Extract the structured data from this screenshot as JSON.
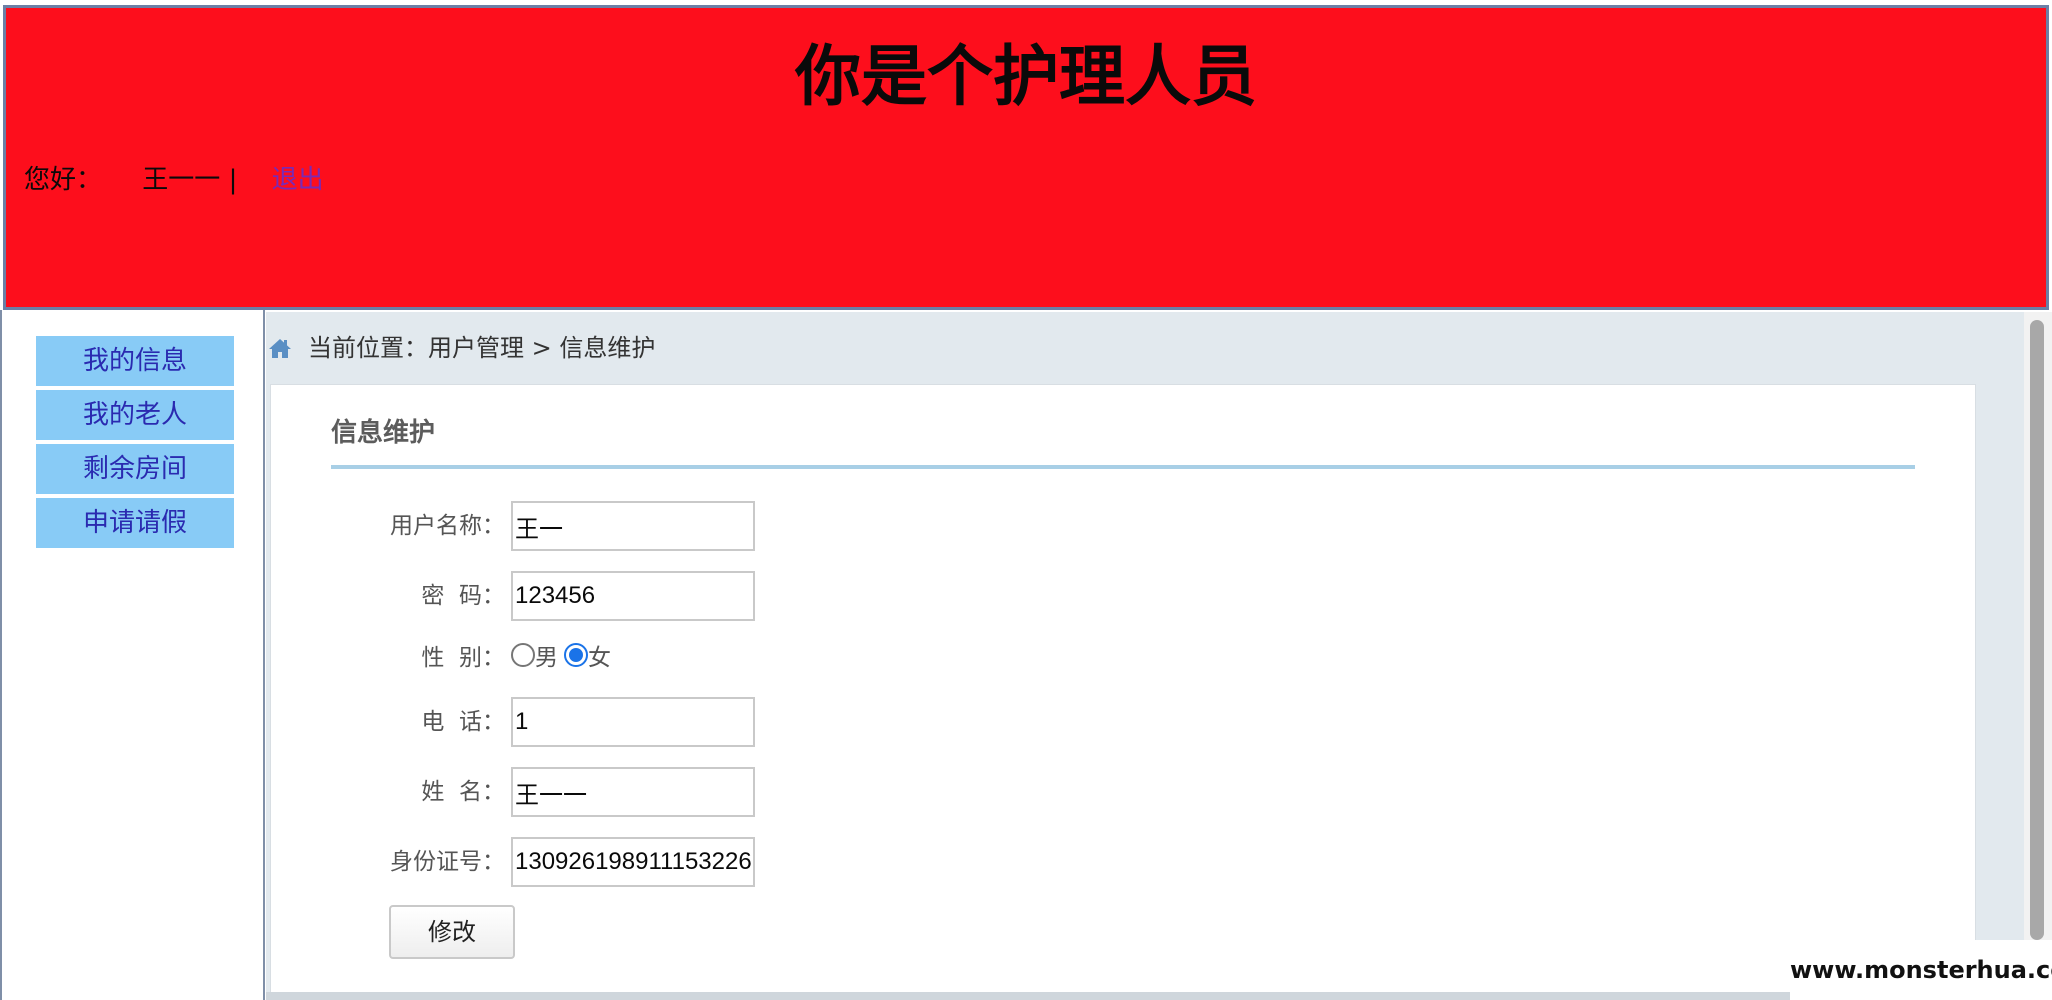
{
  "header": {
    "title": "你是个护理人员",
    "greeting_label": "您好：",
    "user_name": "王一一",
    "separator": "|",
    "logout_label": "退出"
  },
  "sidebar": {
    "items": [
      {
        "label": "我的信息"
      },
      {
        "label": "我的老人"
      },
      {
        "label": "剩余房间"
      },
      {
        "label": "申请请假"
      }
    ]
  },
  "breadcrumb": {
    "label": "当前位置：",
    "path": "用户管理 > 信息维护"
  },
  "panel": {
    "title": "信息维护"
  },
  "form": {
    "username": {
      "label": "用户名称：",
      "value": "王一"
    },
    "password": {
      "label": "密  码：",
      "value": "123456"
    },
    "gender": {
      "label": "性  别：",
      "options": [
        {
          "label": "男",
          "checked": false
        },
        {
          "label": "女",
          "checked": true
        }
      ]
    },
    "phone": {
      "label": "电  话：",
      "value": "1"
    },
    "realname": {
      "label": "姓  名：",
      "value": "王一一"
    },
    "idcard": {
      "label": "身份证号：",
      "value": "130926198911153226"
    },
    "submit_label": "修改"
  },
  "watermark": "www.monsterhua.com",
  "colors": {
    "header_bg": "#fd0e1c",
    "menu_bg": "#88cbf6",
    "menu_text": "#2a2ab0",
    "logout_link": "#7a2ab5",
    "content_bg": "#e2e9ee",
    "panel_rule": "#a8cfe6",
    "radio_checked": "#1a73e8"
  },
  "icons": {
    "breadcrumb": "home-icon"
  }
}
